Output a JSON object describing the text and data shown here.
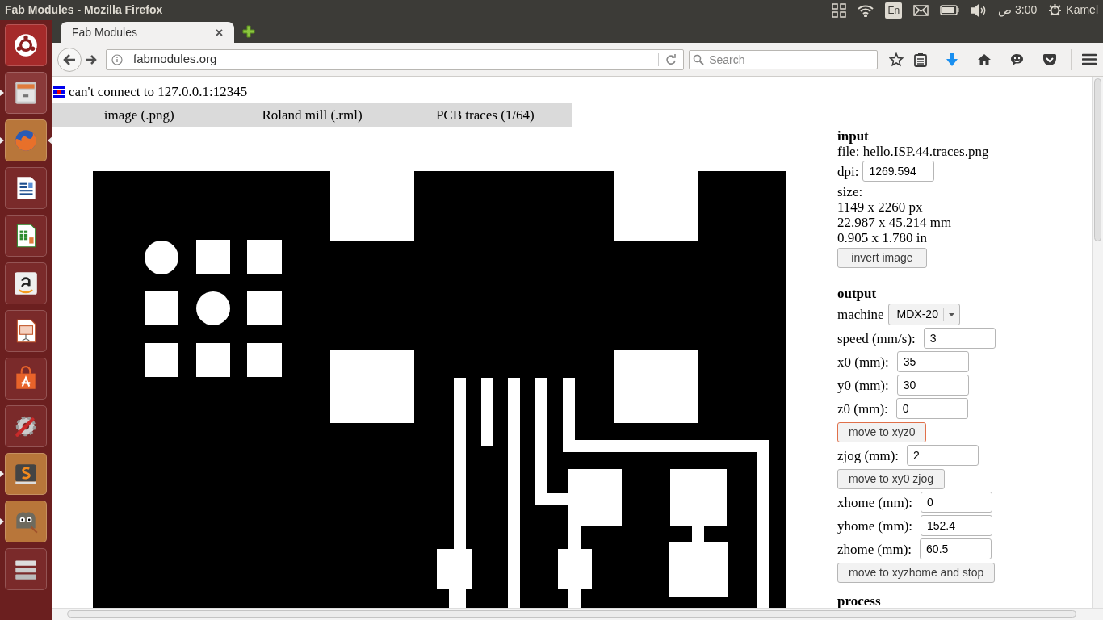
{
  "window": {
    "title": "Fab Modules - Mozilla Firefox"
  },
  "top_panel": {
    "keyboard": "En",
    "clock": "3:00 ص",
    "user": "Kamel"
  },
  "launcher": [
    {
      "kind": "ubuntu",
      "running": false,
      "focused": false
    },
    {
      "kind": "files",
      "running": true,
      "focused": false
    },
    {
      "kind": "firefox",
      "running": true,
      "focused": true
    },
    {
      "kind": "writer",
      "running": false,
      "focused": false
    },
    {
      "kind": "calc",
      "running": false,
      "focused": false
    },
    {
      "kind": "amazon",
      "running": false,
      "focused": false
    },
    {
      "kind": "impress",
      "running": false,
      "focused": false
    },
    {
      "kind": "software",
      "running": false,
      "focused": false
    },
    {
      "kind": "settings",
      "running": false,
      "focused": false
    },
    {
      "kind": "sublime",
      "running": true,
      "focused": false
    },
    {
      "kind": "gimp",
      "running": true,
      "focused": false
    },
    {
      "kind": "drives",
      "running": false,
      "focused": false
    }
  ],
  "tabs": [
    {
      "label": "Fab Modules",
      "selected": true
    }
  ],
  "address_bar": {
    "url": "fabmodules.org"
  },
  "search": {
    "placeholder": "Search"
  },
  "page": {
    "status": "can't connect to 127.0.0.1:12345",
    "menu": [
      "image (.png)",
      "Roland mill (.rml)",
      "PCB traces (1/64)"
    ],
    "input": {
      "heading": "input",
      "file": "file: hello.ISP.44.traces.png",
      "dpi_label": "dpi:",
      "dpi": "1269.594",
      "size_label": "size:",
      "size": [
        "1149 x 2260 px",
        "22.987 x 45.214 mm",
        "0.905 x 1.780 in"
      ],
      "button": "invert image"
    },
    "output": {
      "heading": "output",
      "machine_label": "machine",
      "machine": "MDX-20",
      "rows": [
        {
          "kind": "field",
          "label": "speed (mm/s):",
          "value": "3"
        },
        {
          "kind": "field",
          "label": "x0 (mm):",
          "value": "35"
        },
        {
          "kind": "field",
          "label": "y0 (mm):",
          "value": "30"
        },
        {
          "kind": "field",
          "label": "z0 (mm):",
          "value": "0"
        },
        {
          "kind": "button",
          "label": "move to xyz0",
          "focused": true
        },
        {
          "kind": "field",
          "label": "zjog (mm):",
          "value": "2"
        },
        {
          "kind": "button",
          "label": "move to xy0 zjog",
          "focused": false
        },
        {
          "kind": "field",
          "label": "xhome (mm):",
          "value": "0"
        },
        {
          "kind": "field",
          "label": "yhome (mm):",
          "value": "152.4"
        },
        {
          "kind": "field",
          "label": "zhome (mm):",
          "value": "60.5"
        },
        {
          "kind": "button",
          "label": "move to xyzhome and stop",
          "focused": false
        }
      ]
    },
    "process": {
      "heading": "process"
    }
  }
}
